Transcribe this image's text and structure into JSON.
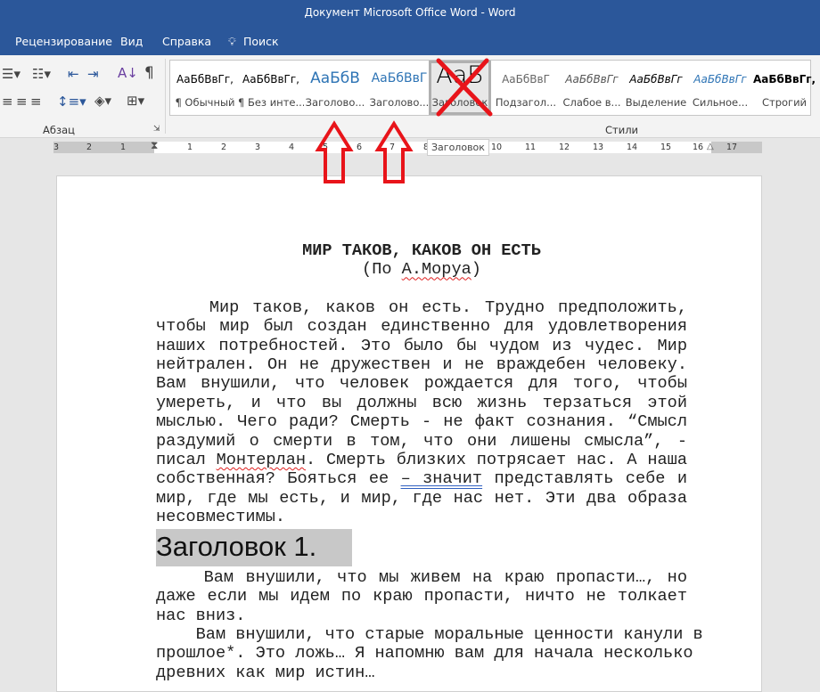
{
  "window": {
    "title": "Документ Microsoft Office Word  -  Word"
  },
  "tabs": [
    {
      "label": "Рецензирование"
    },
    {
      "label": "Вид"
    },
    {
      "label": "Справка"
    },
    {
      "label": "Поиск",
      "icon": "lightbulb-icon"
    }
  ],
  "ribbon": {
    "paragraph_group": "Абзац",
    "styles_group": "Стили",
    "styles": [
      {
        "preview": "АаБбВвГг,",
        "name": "¶ Обычный"
      },
      {
        "preview": "АаБбВвГг,",
        "name": "¶ Без инте..."
      },
      {
        "preview": "АаБбВ",
        "name": "Заголово..."
      },
      {
        "preview": "АаБбВвГ",
        "name": "Заголово..."
      },
      {
        "preview": "АаБ",
        "name": "Заголовок"
      },
      {
        "preview": "АаБбВвГ",
        "name": "Подзагол..."
      },
      {
        "preview": "АаБбВвГг",
        "name": "Слабое в..."
      },
      {
        "preview": "АаБбВвГг",
        "name": "Выделение"
      },
      {
        "preview": "АаБбВвГг",
        "name": "Сильное..."
      },
      {
        "preview": "АаБбВвГг,",
        "name": "Строгий"
      }
    ],
    "selected_style": "Заголовок"
  },
  "ruler": {
    "numbers": [
      "3",
      "2",
      "1",
      "1",
      "2",
      "3",
      "4",
      "5",
      "6",
      "7",
      "8",
      "9",
      "10",
      "11",
      "12",
      "13",
      "14",
      "15",
      "16",
      "17"
    ]
  },
  "tooltip": "Заголовок",
  "document": {
    "title": "МИР ТАКОВ, КАКОВ ОН ЕСТЬ",
    "subtitle": [
      {
        "t": "(По "
      },
      {
        "t": "А.Моруа",
        "u": "spell"
      },
      {
        "t": ")"
      }
    ],
    "para1": [
      [
        {
          "t": "    Мир таков, каков он есть. Трудно предположить,"
        }
      ],
      [
        {
          "t": "чтобы мир был создан единственно для удовлетворения"
        }
      ],
      [
        {
          "t": "наших потребностей. Это было бы чудом из чудес. Мир"
        }
      ],
      [
        {
          "t": "нейтрален. Он не дружествен и не враждебен человеку."
        }
      ],
      [
        {
          "t": "Вам внушили, что человек рождается для того, чтобы"
        }
      ],
      [
        {
          "t": "умереть, и что вы должны всю жизнь терзаться этой"
        }
      ],
      [
        {
          "t": "мыслью. Чего ради? Смерть - не факт сознания. “Смысл"
        }
      ],
      [
        {
          "t": "раздумий о смерти в том, что они лишены смысла”, -"
        }
      ],
      [
        {
          "t": "писал "
        },
        {
          "t": "Монтерлан",
          "u": "spell"
        },
        {
          "t": ". Смерть близких потрясает нас. А наша"
        }
      ],
      [
        {
          "t": "собственная? Бояться ее "
        },
        {
          "t": "– значит",
          "u": "gram"
        },
        {
          "t": " представлять себе и"
        }
      ],
      [
        {
          "t": "мир, где мы есть, и мир, где нас нет. Эти два образа"
        }
      ],
      [
        {
          "t": "несовместимы."
        }
      ]
    ],
    "heading": "Заголовок 1.",
    "para2": [
      [
        {
          "t": "    Вам внушили, что мы живем на краю пропасти…, но"
        }
      ],
      [
        {
          "t": "даже если мы идем по краю пропасти, ничто не толкает"
        }
      ],
      [
        {
          "t": "нас вниз."
        }
      ]
    ],
    "para3": [
      [
        {
          "t": "    Вам внушили, что старые моральные ценности канули в"
        }
      ],
      [
        {
          "t": "прошлое*. Это ложь… Я напомню вам для начала несколько"
        }
      ],
      [
        {
          "t": "древних как мир истин…"
        }
      ]
    ]
  },
  "colors": {
    "titlebar": "#2b579a",
    "annotation": "#e8141a",
    "heading_highlight": "#c8c8c8"
  }
}
